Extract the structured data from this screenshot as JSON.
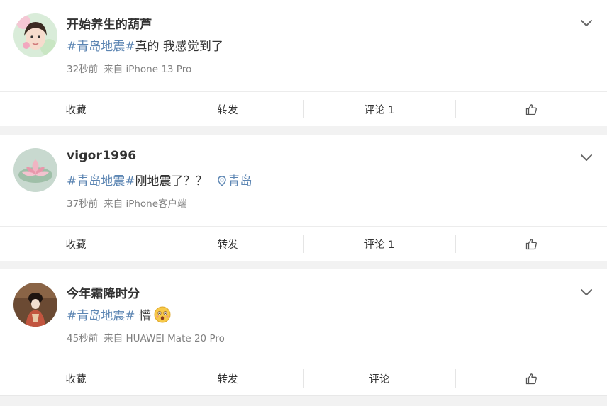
{
  "posts": [
    {
      "username": "开始养生的葫芦",
      "topic": "#青岛地震#",
      "text": "真的 我感觉到了",
      "location": "",
      "time": "32秒前",
      "source": "来自 iPhone 13 Pro",
      "actions": {
        "favorite": "收藏",
        "repost": "转发",
        "comment": "评论 1"
      }
    },
    {
      "username": "vigor1996",
      "topic": "#青岛地震#",
      "text": "刚地震了？？",
      "location": "青岛",
      "time": "37秒前",
      "source": "来自 iPhone客户端",
      "actions": {
        "favorite": "收藏",
        "repost": "转发",
        "comment": "评论 1"
      }
    },
    {
      "username": "今年霜降时分",
      "topic": "#青岛地震#",
      "text": " 懵",
      "location": "",
      "time": "45秒前",
      "source": "来自 HUAWEI Mate 20 Pro",
      "actions": {
        "favorite": "收藏",
        "repost": "转发",
        "comment": "评论"
      }
    }
  ],
  "colors": {
    "topic": "#5d86b3",
    "meta": "#808080",
    "background": "#f2f2f2"
  },
  "icons": [
    "chevron-down-icon",
    "location-pin-icon",
    "thumbs-up-icon",
    "shocked-emoji-icon"
  ]
}
